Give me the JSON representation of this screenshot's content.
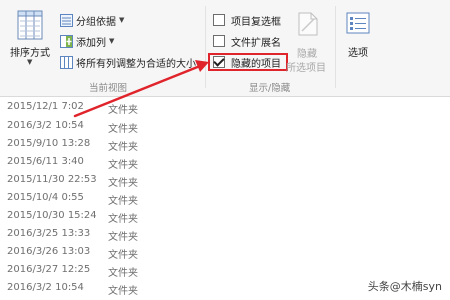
{
  "ribbon": {
    "sort": {
      "label": "排序方式"
    },
    "group_by": {
      "label": "分组依据"
    },
    "add_column": {
      "label": "添加列"
    },
    "fit_columns": {
      "label": "将所有列调整为合适的大小"
    },
    "current_view_label": "当前视图",
    "checkboxes": [
      {
        "label": "项目复选框",
        "checked": false
      },
      {
        "label": "文件扩展名",
        "checked": false
      },
      {
        "label": "隐藏的项目",
        "checked": true
      }
    ],
    "hide_selected": {
      "line1": "隐藏",
      "line2": "所选项目"
    },
    "show_hide_label": "显示/隐藏",
    "options": {
      "label": "选项"
    }
  },
  "files": [
    {
      "date": "2015/12/1 7:02",
      "type": "文件夹"
    },
    {
      "date": "2016/3/2 10:54",
      "type": "文件夹"
    },
    {
      "date": "2015/9/10 13:28",
      "type": "文件夹"
    },
    {
      "date": "2015/6/11 3:40",
      "type": "文件夹"
    },
    {
      "date": "2015/11/30 22:53",
      "type": "文件夹"
    },
    {
      "date": "2015/10/4 0:55",
      "type": "文件夹"
    },
    {
      "date": "2015/10/30 15:24",
      "type": "文件夹"
    },
    {
      "date": "2016/3/25 13:33",
      "type": "文件夹"
    },
    {
      "date": "2016/3/26 13:03",
      "type": "文件夹"
    },
    {
      "date": "2016/3/27 12:25",
      "type": "文件夹"
    },
    {
      "date": "2016/3/2 10:54",
      "type": "文件夹"
    }
  ],
  "watermark": "头条@木楠syn",
  "colors": {
    "highlight": "#e0242b",
    "arrow": "#e0242b"
  }
}
